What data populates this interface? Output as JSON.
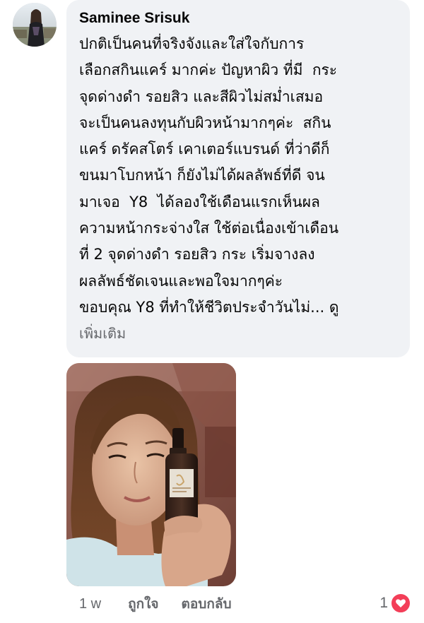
{
  "comment": {
    "author": "Saminee Srisuk",
    "text_lines": [
      "ปกติเป็นคนที่จริงจังและใส่ใจกับการ",
      "เลือกสกินแคร์ มากค่ะ ปัญหาผิว ที่มี  กระ",
      "จุดด่างดำ รอยสิว และสีผิวไม่สม่ำเสมอ",
      "จะเป็นคนลงทุนกับผิวหน้ามากๆค่ะ  สกิน",
      "แคร์ ดรัคสโตร์ เคาเตอร์แบรนด์ ที่ว่าดีก็",
      "ขนมาโบกหน้า ก็ยังไม่ได้ผลลัพธ์ที่ดี จน",
      "มาเจอ  Y8  ได้ลองใช้เดือนแรกเห็นผล",
      "ความหน้ากระจ่างใส ใช้ต่อเนื่องเข้าเดือน",
      "ที่ 2 จุดด่างดำ รอยสิว กระ เริ่มจางลง",
      "ผลลัพธ์ชัดเจนและพอใจมากๆค่ะ",
      "ขอบคุณ Y8 ที่ทำให้ชีวิตประจำวันไม่... ดู"
    ],
    "see_more_label": "เพิ่มเติม"
  },
  "footer": {
    "time": "1 w",
    "like_label": "ถูกใจ",
    "reply_label": "ตอบกลับ"
  },
  "reactions": {
    "count": "1",
    "icon": "heart-icon",
    "color": "#f33e58"
  },
  "colors": {
    "bubble_bg": "#f0f2f5",
    "text": "#050505",
    "secondary_text": "#65676b"
  }
}
